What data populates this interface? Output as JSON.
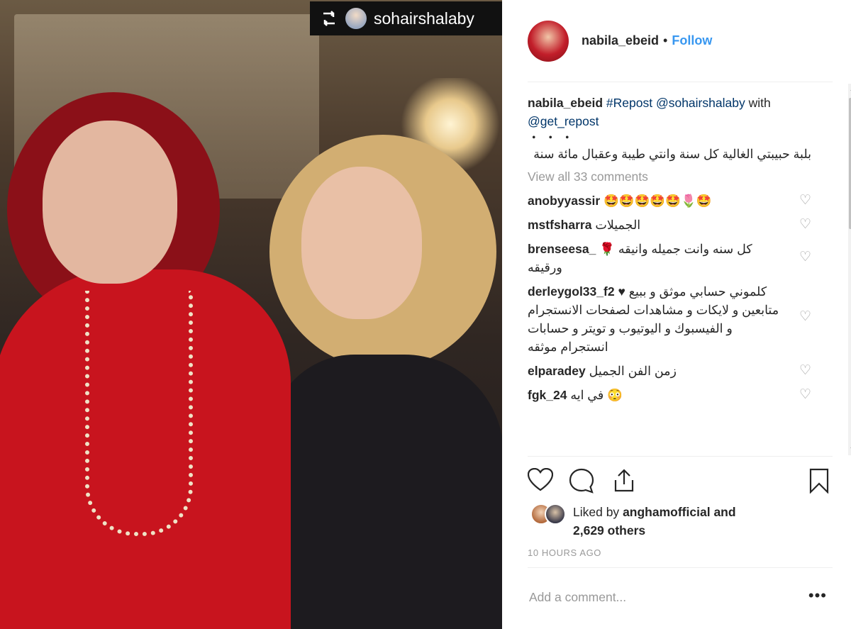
{
  "post": {
    "image_alt": "Photo of two women posing together at an evening event",
    "repost_badge": {
      "username": "sohairshalaby"
    }
  },
  "header": {
    "username": "nabila_ebeid",
    "separator": "•",
    "follow_label": "Follow"
  },
  "caption": {
    "username": "nabila_ebeid",
    "tag": "#Repost",
    "mention": "@sohairshalaby",
    "with_text": "with",
    "via": "@get_repost",
    "ellipsis": "・・・",
    "text": "بلبة حبيبتي الغالية كل سنة وانتي طيبة وعقبال مائة سنة"
  },
  "view_all": "View all 33 comments",
  "comments": [
    {
      "username": "anobyyassir",
      "text": "🤩🤩🤩🤩🤩🌷🤩"
    },
    {
      "username": "mstfsharra",
      "text": "الجميلات"
    },
    {
      "username": "brenseesa_",
      "text": "كل سنه وانت جميله وانيقه 🌹 ورقيقه"
    },
    {
      "username": "derleygol33_f2",
      "text": "♥ كلموني حسابي موثق و ببيع متابعين و لايكات و مشاهدات لصفحات الانستجرام و الفيسبوك و اليوتيوب و تويتر و حسابات انستجرام موثقه"
    },
    {
      "username": "elparadey",
      "text": "زمن الفن الجميل"
    },
    {
      "username": "fgk_24",
      "text": "في ايه 😳"
    }
  ],
  "likes": {
    "prefix": "Liked by",
    "user": "anghamofficial",
    "and": "and",
    "others": "2,629 others"
  },
  "timestamp": "10 HOURS AGO",
  "add_comment": {
    "placeholder": "Add a comment...",
    "more": "•••"
  },
  "colors": {
    "link": "#003569",
    "follow": "#3897f0",
    "muted": "#999999"
  },
  "icons": [
    "like-heart-icon",
    "comment-icon",
    "share-icon",
    "bookmark-icon",
    "comment-like-heart-icon",
    "repost-icon"
  ]
}
